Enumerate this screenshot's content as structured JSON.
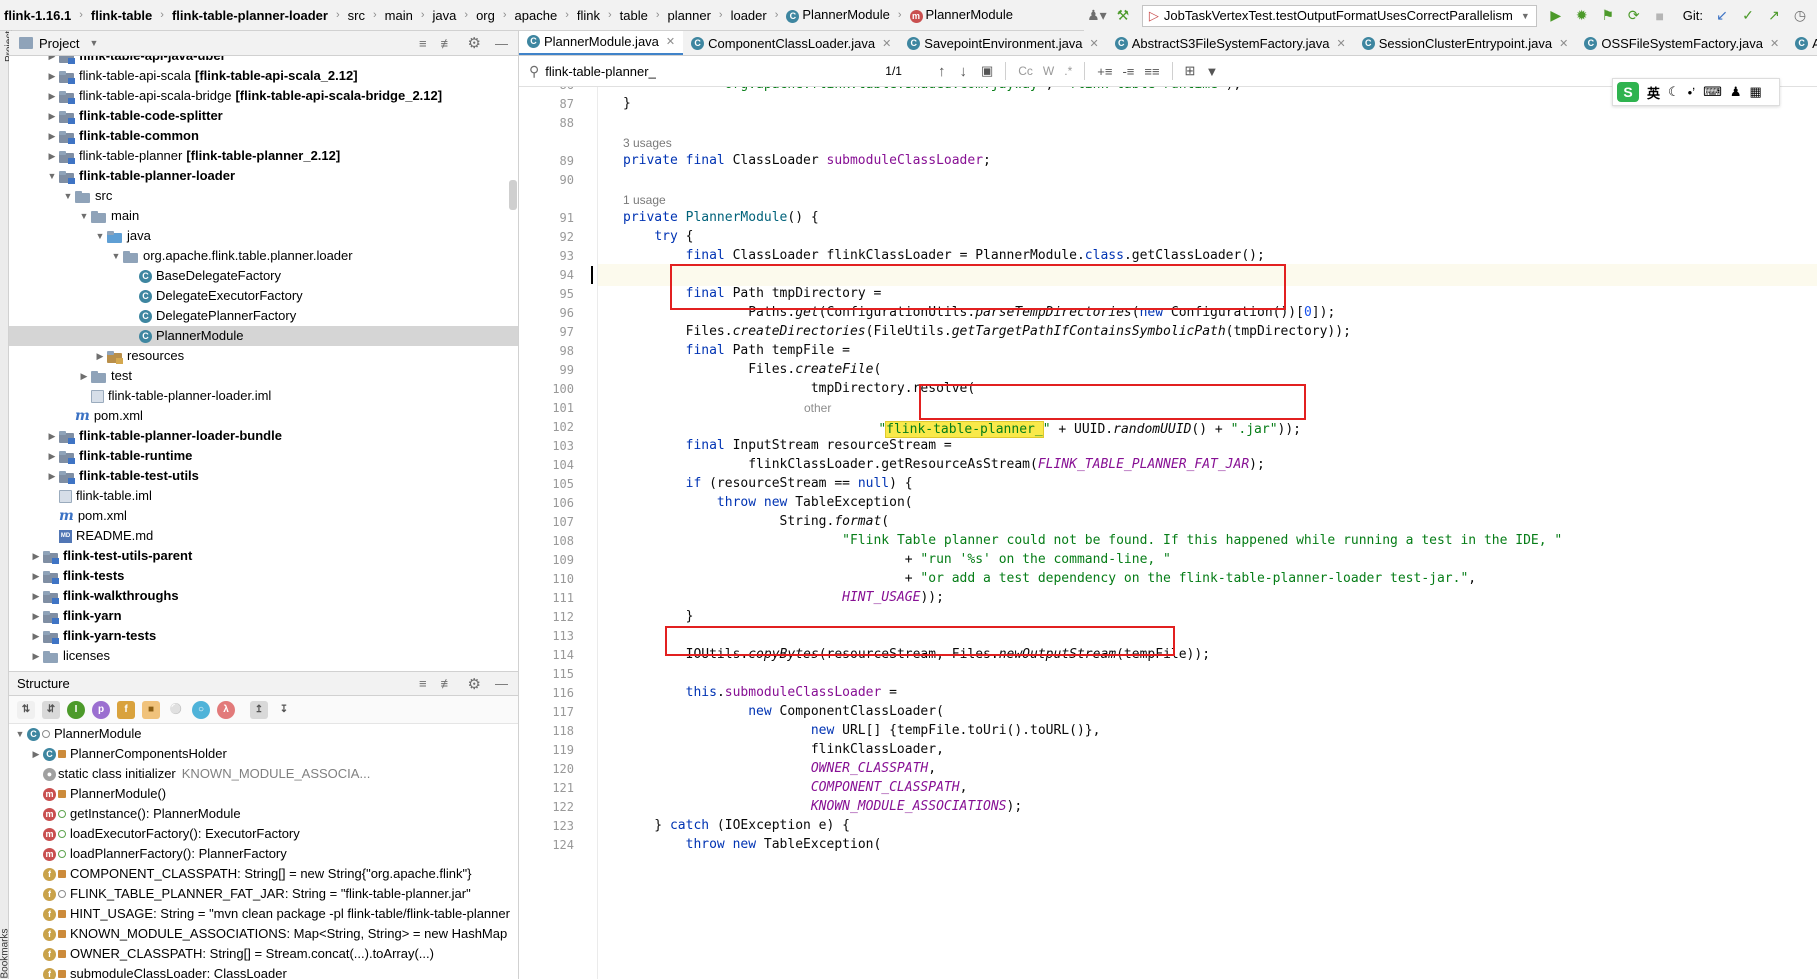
{
  "breadcrumb": [
    "flink-1.16.1",
    "flink-table",
    "flink-table-planner-loader",
    "src",
    "main",
    "java",
    "org",
    "apache",
    "flink",
    "table",
    "planner",
    "loader",
    "PlannerModule",
    "PlannerModule"
  ],
  "toolbar": {
    "run_config": "JobTaskVertexTest.testOutputFormatUsesCorrectParallelism",
    "git_label": "Git:"
  },
  "project_panel": {
    "title": "Project",
    "tree": [
      {
        "label": "flink-table-api-java-uber",
        "bold": true,
        "indent": 2,
        "arrow": "right",
        "icon": "module"
      },
      {
        "label": "flink-table-api-scala",
        "suffix": "[flink-table-api-scala_2.12]",
        "indent": 2,
        "arrow": "right",
        "icon": "module"
      },
      {
        "label": "flink-table-api-scala-bridge",
        "suffix": "[flink-table-api-scala-bridge_2.12]",
        "indent": 2,
        "arrow": "right",
        "icon": "module"
      },
      {
        "label": "flink-table-code-splitter",
        "bold": true,
        "indent": 2,
        "arrow": "right",
        "icon": "module"
      },
      {
        "label": "flink-table-common",
        "bold": true,
        "indent": 2,
        "arrow": "right",
        "icon": "module"
      },
      {
        "label": "flink-table-planner",
        "suffix": "[flink-table-planner_2.12]",
        "indent": 2,
        "arrow": "right",
        "icon": "module"
      },
      {
        "label": "flink-table-planner-loader",
        "bold": true,
        "indent": 2,
        "arrow": "down",
        "icon": "module"
      },
      {
        "label": "src",
        "indent": 3,
        "arrow": "down",
        "icon": "folder"
      },
      {
        "label": "main",
        "indent": 4,
        "arrow": "down",
        "icon": "folder"
      },
      {
        "label": "java",
        "indent": 5,
        "arrow": "down",
        "icon": "src"
      },
      {
        "label": "org.apache.flink.table.planner.loader",
        "indent": 6,
        "arrow": "down",
        "icon": "folder"
      },
      {
        "label": "BaseDelegateFactory",
        "indent": 7,
        "arrow": "",
        "icon": "class"
      },
      {
        "label": "DelegateExecutorFactory",
        "indent": 7,
        "arrow": "",
        "icon": "class"
      },
      {
        "label": "DelegatePlannerFactory",
        "indent": 7,
        "arrow": "",
        "icon": "class"
      },
      {
        "label": "PlannerModule",
        "indent": 7,
        "arrow": "",
        "icon": "class",
        "selected": true
      },
      {
        "label": "resources",
        "indent": 5,
        "arrow": "right",
        "icon": "res"
      },
      {
        "label": "test",
        "indent": 4,
        "arrow": "right",
        "icon": "folder"
      },
      {
        "label": "flink-table-planner-loader.iml",
        "indent": 4,
        "arrow": "",
        "icon": "file"
      },
      {
        "label": "pom.xml",
        "indent": 3,
        "arrow": "",
        "icon": "maven"
      },
      {
        "label": "flink-table-planner-loader-bundle",
        "bold": true,
        "indent": 2,
        "arrow": "right",
        "icon": "module"
      },
      {
        "label": "flink-table-runtime",
        "bold": true,
        "indent": 2,
        "arrow": "right",
        "icon": "module"
      },
      {
        "label": "flink-table-test-utils",
        "bold": true,
        "indent": 2,
        "arrow": "right",
        "icon": "module"
      },
      {
        "label": "flink-table.iml",
        "indent": 2,
        "arrow": "",
        "icon": "file"
      },
      {
        "label": "pom.xml",
        "indent": 2,
        "arrow": "",
        "icon": "maven"
      },
      {
        "label": "README.md",
        "indent": 2,
        "arrow": "",
        "icon": "md"
      },
      {
        "label": "flink-test-utils-parent",
        "bold": true,
        "indent": 1,
        "arrow": "right",
        "icon": "module"
      },
      {
        "label": "flink-tests",
        "bold": true,
        "indent": 1,
        "arrow": "right",
        "icon": "module"
      },
      {
        "label": "flink-walkthroughs",
        "bold": true,
        "indent": 1,
        "arrow": "right",
        "icon": "module"
      },
      {
        "label": "flink-yarn",
        "bold": true,
        "indent": 1,
        "arrow": "right",
        "icon": "module"
      },
      {
        "label": "flink-yarn-tests",
        "bold": true,
        "indent": 1,
        "arrow": "right",
        "icon": "module"
      },
      {
        "label": "licenses",
        "indent": 1,
        "arrow": "right",
        "icon": "folder"
      }
    ]
  },
  "structure_panel": {
    "title": "Structure",
    "items": [
      {
        "label": "PlannerModule",
        "icon": "class",
        "arrow": "down",
        "indent": 0,
        "access": "pkg"
      },
      {
        "label": "PlannerComponentsHolder",
        "icon": "class",
        "arrow": "right",
        "indent": 1,
        "access": "lock"
      },
      {
        "label": "static class initializer",
        "gray": "KNOWN_MODULE_ASSOCIA...",
        "icon": "static",
        "arrow": "",
        "indent": 1,
        "access": ""
      },
      {
        "label": "PlannerModule()",
        "icon": "method",
        "arrow": "",
        "indent": 1,
        "access": "lock"
      },
      {
        "label": "getInstance(): PlannerModule",
        "icon": "method",
        "arrow": "",
        "indent": 1,
        "access": "pub"
      },
      {
        "label": "loadExecutorFactory(): ExecutorFactory",
        "icon": "method",
        "arrow": "",
        "indent": 1,
        "access": "pub"
      },
      {
        "label": "loadPlannerFactory(): PlannerFactory",
        "icon": "method",
        "arrow": "",
        "indent": 1,
        "access": "pub"
      },
      {
        "label": "COMPONENT_CLASSPATH: String[] = new String{\"org.apache.flink\"}",
        "icon": "field",
        "arrow": "",
        "indent": 1,
        "access": "lock"
      },
      {
        "label": "FLINK_TABLE_PLANNER_FAT_JAR: String = \"flink-table-planner.jar\"",
        "icon": "field",
        "arrow": "",
        "indent": 1,
        "access": "pkg"
      },
      {
        "label": "HINT_USAGE: String = \"mvn clean package -pl flink-table/flink-table-planner",
        "icon": "field",
        "arrow": "",
        "indent": 1,
        "access": "lock"
      },
      {
        "label": "KNOWN_MODULE_ASSOCIATIONS: Map<String, String> = new HashMap",
        "icon": "field",
        "arrow": "",
        "indent": 1,
        "access": "lock"
      },
      {
        "label": "OWNER_CLASSPATH: String[] = Stream.concat(...).toArray(...)",
        "icon": "field",
        "arrow": "",
        "indent": 1,
        "access": "lock"
      },
      {
        "label": "submoduleClassLoader: ClassLoader",
        "icon": "field",
        "arrow": "",
        "indent": 1,
        "access": "lock"
      }
    ]
  },
  "side_labels": {
    "project": "Project",
    "bookmarks": "Bookmarks"
  },
  "editor_tabs": [
    {
      "label": "PlannerModule.java",
      "active": true
    },
    {
      "label": "ComponentClassLoader.java"
    },
    {
      "label": "SavepointEnvironment.java"
    },
    {
      "label": "AbstractS3FileSystemFactory.java"
    },
    {
      "label": "SessionClusterEntrypoint.java"
    },
    {
      "label": "OSSFileSystemFactory.java"
    },
    {
      "label": "Akka"
    }
  ],
  "find": {
    "query": "flink-table-planner_",
    "match_count": "1/1",
    "cc": "Cc",
    "w": "W",
    "regex": ".*"
  },
  "ime": {
    "label": "英"
  },
  "usages": {
    "l89": "3 usages",
    "l91": "1 usage"
  },
  "inlay_hint": "other",
  "code_lines": [
    {
      "n": "86",
      "html": "            <span class=\"str\">\"org.apache.flink.table.shaded.com.jayway\"</span>, <span class=\"str\">\"flink-table-runtime\"</span>);"
    },
    {
      "n": "87",
      "html": "}"
    },
    {
      "n": "88",
      "html": ""
    },
    {
      "n": "89",
      "html": "<span class=\"kw\">private final</span> ClassLoader <span class=\"fld\">submoduleClassLoader</span>;"
    },
    {
      "n": "90",
      "html": ""
    },
    {
      "n": "91",
      "html": "<span class=\"kw\">private</span> <span class=\"mth\">PlannerModule</span>() {"
    },
    {
      "n": "92",
      "html": "    <span class=\"kw\">try</span> {"
    },
    {
      "n": "93",
      "html": "        <span class=\"kw\">final</span> ClassLoader flinkClassLoader = PlannerModule.<span class=\"kw\">class</span>.getClassLoader();"
    },
    {
      "n": "94",
      "html": ""
    },
    {
      "n": "95",
      "html": "        <span class=\"kw\">final</span> Path tmpDirectory ="
    },
    {
      "n": "96",
      "html": "                Paths.<span class=\"it\">get</span>(ConfigurationUtils.<span class=\"it\">parseTempDirectories</span>(<span class=\"kw\">new</span> Configuration())[<span class=\"num\">0</span>]);"
    },
    {
      "n": "97",
      "html": "        Files.<span class=\"it\">createDirectories</span>(FileUtils.<span class=\"it\">getTargetPathIfContainsSymbolicPath</span>(tmpDirectory));"
    },
    {
      "n": "98",
      "html": "        <span class=\"kw\">final</span> Path tempFile ="
    },
    {
      "n": "99",
      "html": "                Files.<span class=\"it\">createFile</span>("
    },
    {
      "n": "100",
      "html": "                        tmpDirectory.resolve("
    },
    {
      "n": "101",
      "html": ""
    },
    {
      "n": "102",
      "html": ""
    },
    {
      "n": "103",
      "html": "        <span class=\"kw\">final</span> InputStream resourceStream ="
    },
    {
      "n": "104",
      "html": "                flinkClassLoader.getResourceAsStream(<span class=\"cst\">FLINK_TABLE_PLANNER_FAT_JAR</span>);"
    },
    {
      "n": "105",
      "html": "        <span class=\"kw\">if</span> (resourceStream == <span class=\"kw\">null</span>) {"
    },
    {
      "n": "106",
      "html": "            <span class=\"kw\">throw new</span> TableException("
    },
    {
      "n": "107",
      "html": "                    String.<span class=\"it\">format</span>("
    },
    {
      "n": "108",
      "html": "                            <span class=\"str\">\"Flink Table planner could not be found. If this happened while running a test in the IDE, \"</span>"
    },
    {
      "n": "109",
      "html": "                                    + <span class=\"str\">\"run '%s' on the command-line, \"</span>"
    },
    {
      "n": "110",
      "html": "                                    + <span class=\"str\">\"or add a test dependency on the flink-table-planner-loader test-jar.\"</span>,"
    },
    {
      "n": "111",
      "html": "                            <span class=\"cst\">HINT_USAGE</span>));"
    },
    {
      "n": "112",
      "html": "        }"
    },
    {
      "n": "113",
      "html": ""
    },
    {
      "n": "114",
      "html": "        IOUtils.<span class=\"it\">copyBytes</span>(resourceStream, Files.<span class=\"it\">newOutputStream</span>(tempFile));"
    },
    {
      "n": "115",
      "html": ""
    },
    {
      "n": "116",
      "html": "        <span class=\"kw\">this</span>.<span class=\"fld\">submoduleClassLoader</span> ="
    },
    {
      "n": "117",
      "html": "                <span class=\"kw\">new</span> ComponentClassLoader("
    },
    {
      "n": "118",
      "html": "                        <span class=\"kw\">new</span> URL[] {tempFile.toUri().toURL()},"
    },
    {
      "n": "119",
      "html": "                        flinkClassLoader,"
    },
    {
      "n": "120",
      "html": "                        <span class=\"cst\">OWNER_CLASSPATH</span>,"
    },
    {
      "n": "121",
      "html": "                        <span class=\"cst\">COMPONENT_CLASSPATH</span>,"
    },
    {
      "n": "122",
      "html": "                        <span class=\"cst\">KNOWN_MODULE_ASSOCIATIONS</span>);"
    },
    {
      "n": "123",
      "html": "    } <span class=\"kw\">catch</span> (IOException e) {"
    },
    {
      "n": "124",
      "html": "        <span class=\"kw\">throw new</span> TableException("
    }
  ],
  "line101": {
    "hl": "flink-table-planner_",
    "rest": "\" + UUID.randomUUID() + \".jar\"));",
    "q1": "\""
  }
}
